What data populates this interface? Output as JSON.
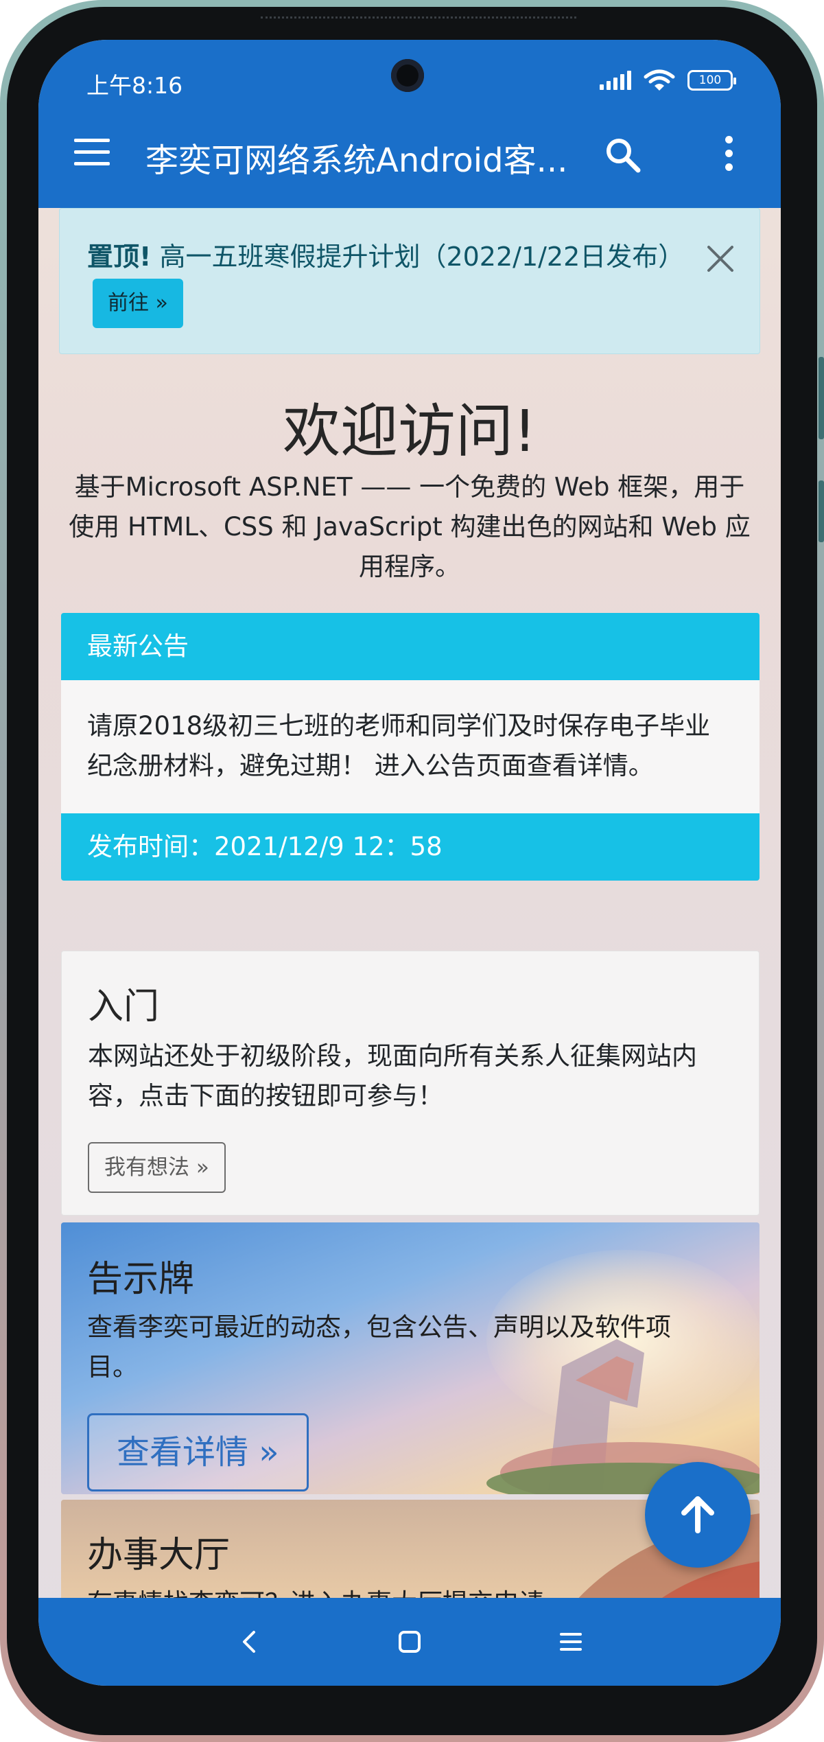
{
  "status_bar": {
    "time": "上午8:16",
    "battery": "100",
    "icons": [
      "signal-icon",
      "wifi-icon",
      "battery-icon"
    ]
  },
  "app_bar": {
    "title": "李奕可网络系统Android客...",
    "menu_icon": "menu-icon",
    "search_icon": "search-icon",
    "more_icon": "more-vert-icon",
    "color": "#1a6fc9"
  },
  "alert": {
    "strong": "置顶!",
    "text": "高一五班寒假提升计划（2022/1/22日发布）",
    "button": "前往 »",
    "close_icon": "close-icon"
  },
  "welcome": {
    "title": "欢迎访问!",
    "description": "基于Microsoft ASP.NET —— 一个免费的 Web 框架，用于使用 HTML、CSS 和 JavaScript 构建出色的网站和 Web 应用程序。"
  },
  "notice": {
    "header": "最新公告",
    "body": "请原2018级初三七班的老师和同学们及时保存电子毕业纪念册材料，避免过期！ 进入公告页面查看详情。",
    "footer": "发布时间：2021/12/9 12：58",
    "accent": "#17c1e6"
  },
  "cards": {
    "start": {
      "title": "入门",
      "text": "本网站还处于初级阶段，现面向所有关系人征集网站内容，点击下面的按钮即可参与！",
      "button": "我有想法 »"
    },
    "board": {
      "title": "告示牌",
      "text": "查看李奕可最近的动态，包含公告、声明以及软件项目。",
      "button": "查看详情 »"
    },
    "hall": {
      "title": "办事大厅",
      "text": "有事情找李奕可？进入办事大厅提交申请。"
    }
  },
  "fab": {
    "icon": "arrow-up-icon"
  },
  "nav_bar": {
    "icons": [
      "back-icon",
      "home-icon",
      "recents-icon"
    ]
  }
}
